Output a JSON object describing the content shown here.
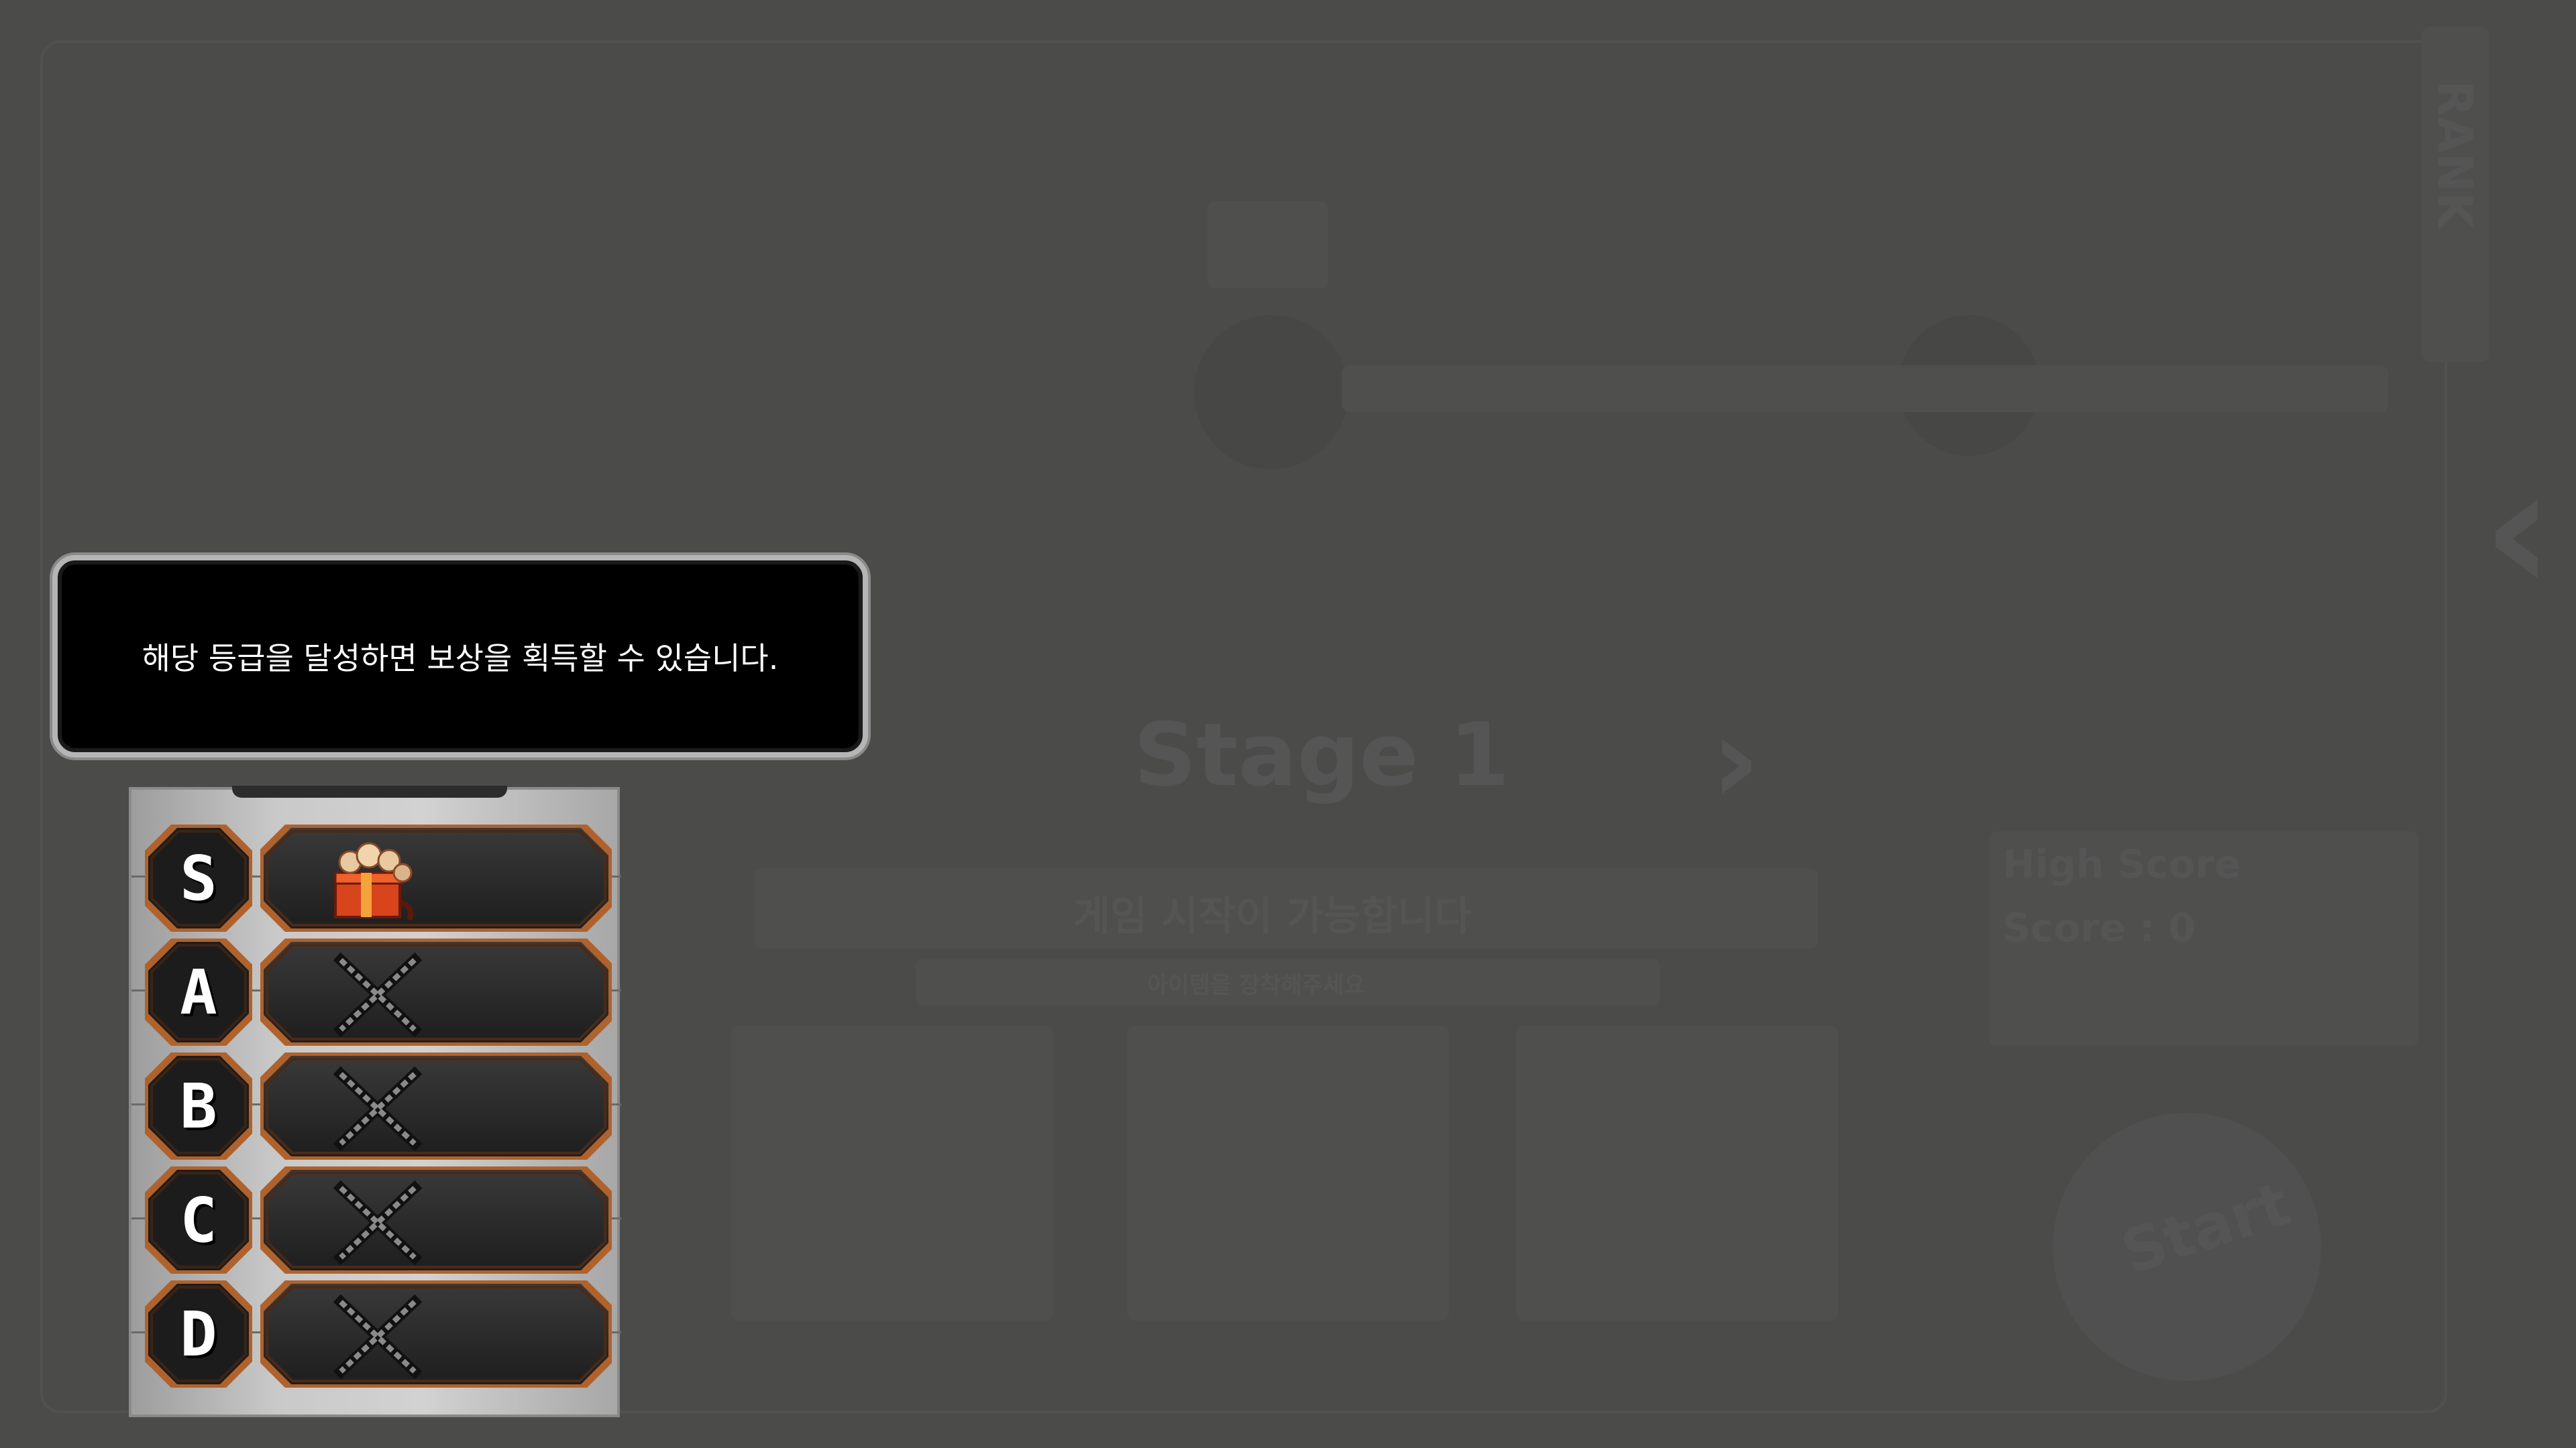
{
  "tooltip": {
    "message": "해당 등급을 달성하면 보상을 획득할 수 있습니다."
  },
  "background": {
    "stage_title": "Stage 1",
    "status_text": "게임 시작이 가능합니다",
    "sub_status_text": "아이템을 장착해주세요",
    "high_score_label": "High Score",
    "score_text": "Score : 0",
    "start_label": "Start",
    "side_tab_label": "RANK"
  },
  "rewards": [
    {
      "grade": "S",
      "reward": "gift-box-icon",
      "locked": false
    },
    {
      "grade": "A",
      "reward": "locked-x-icon",
      "locked": true
    },
    {
      "grade": "B",
      "reward": "locked-x-icon",
      "locked": true
    },
    {
      "grade": "C",
      "reward": "locked-x-icon",
      "locked": true
    },
    {
      "grade": "D",
      "reward": "locked-x-icon",
      "locked": true
    }
  ],
  "colors": {
    "overlay": "#4b4b4a",
    "badge_border": "#b0622c",
    "tooltip_bg": "#000000",
    "tooltip_text": "#ffffff"
  }
}
